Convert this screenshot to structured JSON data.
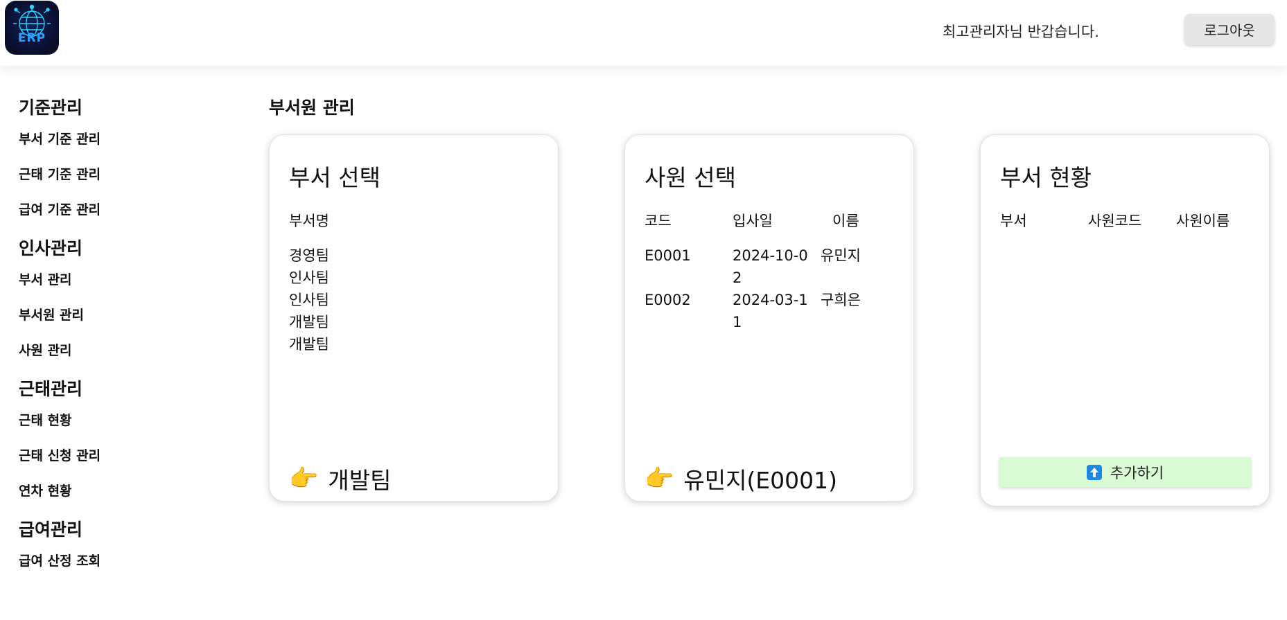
{
  "header": {
    "welcome": "최고관리자님 반갑습니다.",
    "logout_label": "로그아웃",
    "logo_text": "ERP"
  },
  "sidebar": {
    "groups": [
      {
        "title": "기준관리",
        "items": [
          "부서 기준 관리",
          "근태 기준 관리",
          "급여 기준 관리"
        ]
      },
      {
        "title": "인사관리",
        "items": [
          "부서 관리",
          "부서원 관리",
          "사원 관리"
        ]
      },
      {
        "title": "근태관리",
        "items": [
          "근태 현황",
          "근태 신청 관리",
          "연차 현황"
        ]
      },
      {
        "title": "급여관리",
        "items": [
          "급여 산정 조회"
        ]
      }
    ]
  },
  "main": {
    "page_title": "부서원 관리",
    "dept_card": {
      "title": "부서 선택",
      "column": "부서명",
      "departments": [
        "경영팀",
        "인사팀",
        "인사팀",
        "개발팀",
        "개발팀"
      ],
      "selected_icon": "pointing-hand-icon",
      "selected": "개발팀"
    },
    "emp_card": {
      "title": "사원 선택",
      "columns": [
        "코드",
        "입사일",
        "이름"
      ],
      "rows": [
        {
          "code": "E0001",
          "date": "2024-10-02",
          "name": "유민지"
        },
        {
          "code": "E0002",
          "date": "2024-03-11",
          "name": "구희은"
        }
      ],
      "selected_icon": "pointing-hand-icon",
      "selected": "유민지(E0001)"
    },
    "status_card": {
      "title": "부서 현황",
      "columns": [
        "부서",
        "사원코드",
        "사원이름"
      ],
      "add_label": "추가하기",
      "add_icon": "upload-arrow-icon"
    }
  },
  "colors": {
    "add_button_bg": "#dafad6",
    "logout_bg": "#e6e6e6",
    "logo_bg": "#0a0f2e",
    "logo_accent": "#1ec8ff"
  }
}
